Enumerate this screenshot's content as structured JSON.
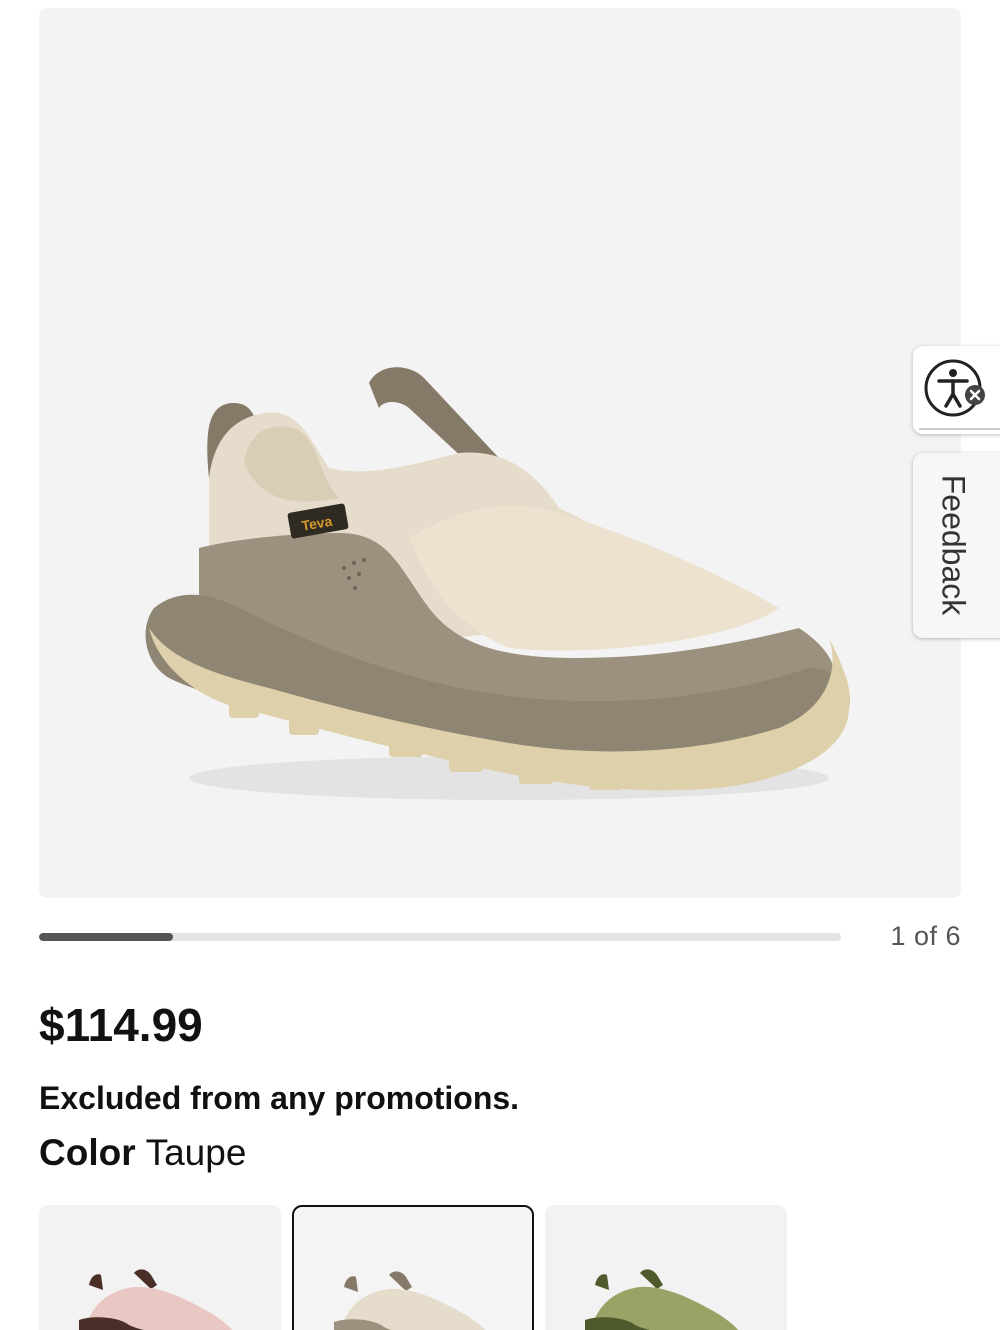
{
  "gallery": {
    "image_alt": "Teva slip-on shoe in Taupe",
    "brand_tag": "Teva",
    "current_slide": 1,
    "total_slides": 6,
    "counter_text": "1 of 6",
    "progress_fraction": 0.1667
  },
  "product": {
    "price": "$114.99",
    "promo_note": "Excluded from any promotions.",
    "color_label": "Color",
    "color_value": "Taupe"
  },
  "swatches": [
    {
      "name": "pink-brown",
      "selected": false,
      "upper": "#e9c7c2",
      "accent": "#4a2e28"
    },
    {
      "name": "taupe",
      "selected": true,
      "upper": "#e5dccb",
      "accent": "#857a68"
    },
    {
      "name": "olive",
      "selected": false,
      "upper": "#9aa366",
      "accent": "#4f5a2c"
    }
  ],
  "side_tabs": {
    "accessibility_icon": "accessibility-icon",
    "feedback_label": "Feedback"
  },
  "colors": {
    "hero_bg": "#f3f3f3",
    "progress_fill": "#555555",
    "progress_track": "#e3e3e3"
  }
}
